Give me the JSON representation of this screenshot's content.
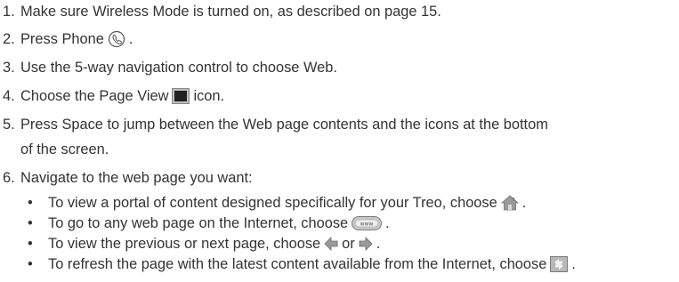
{
  "steps": [
    {
      "num": "1.",
      "text": "Make sure Wireless Mode is turned on, as described on page 15."
    },
    {
      "num": "2.",
      "text": "Press Phone",
      "icon": "phone-key-icon",
      "after": "."
    },
    {
      "num": "3.",
      "text": "Use the 5-way navigation control to choose Web."
    },
    {
      "num": "4.",
      "text": "Choose the Page View",
      "icon": "page-view-icon",
      "after": "icon."
    },
    {
      "num": "5.",
      "text": "Press Space to jump between the Web page contents and the icons at the bottom",
      "continuation": "of the screen."
    },
    {
      "num": "6.",
      "text": "Navigate to the web page you want:"
    }
  ],
  "bullets": [
    {
      "symbol": "•",
      "text": "To view a portal of content designed specifically for your Treo, choose",
      "icon": "home-icon",
      "after": "."
    },
    {
      "symbol": "•",
      "text": "To go to any web page on the Internet, choose",
      "icon": "www-icon",
      "after": "."
    },
    {
      "symbol": "•",
      "text": "To view the previous or next page, choose",
      "icon": "back-arrow-icon",
      "middle": "or",
      "icon2": "forward-arrow-icon",
      "after": "."
    },
    {
      "symbol": "•",
      "text": "To refresh the page with the latest content available from the Internet, choose",
      "icon": "refresh-icon",
      "after": "."
    }
  ],
  "colors": {
    "text": "#333333",
    "icon_gray": "#8a8a8a",
    "icon_dark": "#3a3a3a"
  }
}
